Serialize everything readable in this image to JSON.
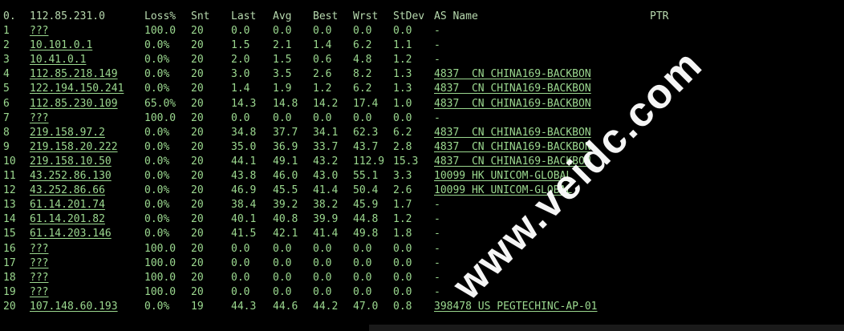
{
  "header": {
    "hop": "0.",
    "host": "112.85.231.0",
    "loss": "Loss%",
    "snt": "Snt",
    "last": "Last",
    "avg": "Avg",
    "best": "Best",
    "wrst": "Wrst",
    "stdev": "StDev",
    "asn": "AS Name",
    "ptr": "PTR"
  },
  "rows": [
    {
      "hop": "1",
      "host": "???",
      "loss": "100.0",
      "snt": "20",
      "last": "0.0",
      "avg": "0.0",
      "best": "0.0",
      "wrst": "0.0",
      "stdev": "0.0",
      "asn": "-"
    },
    {
      "hop": "2",
      "host": "10.101.0.1",
      "loss": "0.0%",
      "snt": "20",
      "last": "1.5",
      "avg": "2.1",
      "best": "1.4",
      "wrst": "6.2",
      "stdev": "1.1",
      "asn": "-"
    },
    {
      "hop": "3",
      "host": "10.41.0.1",
      "loss": "0.0%",
      "snt": "20",
      "last": "2.0",
      "avg": "1.5",
      "best": "0.6",
      "wrst": "4.8",
      "stdev": "1.2",
      "asn": "-"
    },
    {
      "hop": "4",
      "host": "112.85.218.149",
      "loss": "0.0%",
      "snt": "20",
      "last": "3.0",
      "avg": "3.5",
      "best": "2.6",
      "wrst": "8.2",
      "stdev": "1.3",
      "asn": "4837  CN CHINA169-BACKBON"
    },
    {
      "hop": "5",
      "host": "122.194.150.241",
      "loss": "0.0%",
      "snt": "20",
      "last": "1.4",
      "avg": "1.9",
      "best": "1.2",
      "wrst": "6.2",
      "stdev": "1.3",
      "asn": "4837  CN CHINA169-BACKBON"
    },
    {
      "hop": "6",
      "host": "112.85.230.109",
      "loss": "65.0%",
      "snt": "20",
      "last": "14.3",
      "avg": "14.8",
      "best": "14.2",
      "wrst": "17.4",
      "stdev": "1.0",
      "asn": "4837  CN CHINA169-BACKBON"
    },
    {
      "hop": "7",
      "host": "???",
      "loss": "100.0",
      "snt": "20",
      "last": "0.0",
      "avg": "0.0",
      "best": "0.0",
      "wrst": "0.0",
      "stdev": "0.0",
      "asn": "-"
    },
    {
      "hop": "8",
      "host": "219.158.97.2",
      "loss": "0.0%",
      "snt": "20",
      "last": "34.8",
      "avg": "37.7",
      "best": "34.1",
      "wrst": "62.3",
      "stdev": "6.2",
      "asn": "4837  CN CHINA169-BACKBON"
    },
    {
      "hop": "9",
      "host": "219.158.20.222",
      "loss": "0.0%",
      "snt": "20",
      "last": "35.0",
      "avg": "36.9",
      "best": "33.7",
      "wrst": "43.7",
      "stdev": "2.8",
      "asn": "4837  CN CHINA169-BACKBON"
    },
    {
      "hop": "10",
      "host": "219.158.10.50",
      "loss": "0.0%",
      "snt": "20",
      "last": "44.1",
      "avg": "49.1",
      "best": "43.2",
      "wrst": "112.9",
      "stdev": "15.3",
      "asn": "4837  CN CHINA169-BACKBON"
    },
    {
      "hop": "11",
      "host": "43.252.86.130",
      "loss": "0.0%",
      "snt": "20",
      "last": "43.8",
      "avg": "46.0",
      "best": "43.0",
      "wrst": "55.1",
      "stdev": "3.3",
      "asn": "10099 HK UNICOM-GLOBAL"
    },
    {
      "hop": "12",
      "host": "43.252.86.66",
      "loss": "0.0%",
      "snt": "20",
      "last": "46.9",
      "avg": "45.5",
      "best": "41.4",
      "wrst": "50.4",
      "stdev": "2.6",
      "asn": "10099 HK UNICOM-GLOBAL"
    },
    {
      "hop": "13",
      "host": "61.14.201.74",
      "loss": "0.0%",
      "snt": "20",
      "last": "38.4",
      "avg": "39.2",
      "best": "38.2",
      "wrst": "45.9",
      "stdev": "1.7",
      "asn": "-"
    },
    {
      "hop": "14",
      "host": "61.14.201.82",
      "loss": "0.0%",
      "snt": "20",
      "last": "40.1",
      "avg": "40.8",
      "best": "39.9",
      "wrst": "44.8",
      "stdev": "1.2",
      "asn": "-"
    },
    {
      "hop": "15",
      "host": "61.14.203.146",
      "loss": "0.0%",
      "snt": "20",
      "last": "41.5",
      "avg": "42.1",
      "best": "41.4",
      "wrst": "49.8",
      "stdev": "1.8",
      "asn": "-"
    },
    {
      "hop": "16",
      "host": "???",
      "loss": "100.0",
      "snt": "20",
      "last": "0.0",
      "avg": "0.0",
      "best": "0.0",
      "wrst": "0.0",
      "stdev": "0.0",
      "asn": "-"
    },
    {
      "hop": "17",
      "host": "???",
      "loss": "100.0",
      "snt": "20",
      "last": "0.0",
      "avg": "0.0",
      "best": "0.0",
      "wrst": "0.0",
      "stdev": "0.0",
      "asn": "-"
    },
    {
      "hop": "18",
      "host": "???",
      "loss": "100.0",
      "snt": "20",
      "last": "0.0",
      "avg": "0.0",
      "best": "0.0",
      "wrst": "0.0",
      "stdev": "0.0",
      "asn": "-"
    },
    {
      "hop": "19",
      "host": "???",
      "loss": "100.0",
      "snt": "20",
      "last": "0.0",
      "avg": "0.0",
      "best": "0.0",
      "wrst": "0.0",
      "stdev": "0.0",
      "asn": "-"
    },
    {
      "hop": "20",
      "host": "107.148.60.193",
      "loss": "0.0%",
      "snt": "19",
      "last": "44.3",
      "avg": "44.6",
      "best": "44.2",
      "wrst": "47.0",
      "stdev": "0.8",
      "asn": "398478 US PEGTECHINC-AP-01"
    }
  ],
  "watermark": "www.veidc.com",
  "colors": {
    "background": "#000000",
    "text": "#9bd88f",
    "watermark": "#ffffff"
  }
}
